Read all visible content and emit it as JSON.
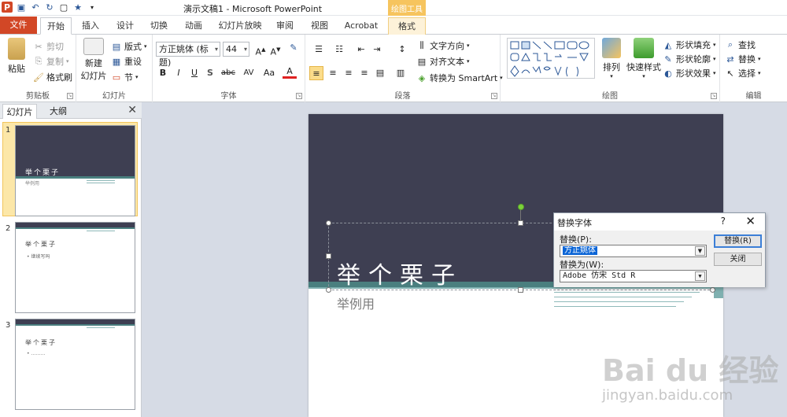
{
  "window": {
    "title": "演示文稿1 - Microsoft PowerPoint",
    "context_tab_header": "绘图工具"
  },
  "tabs": [
    "开始",
    "插入",
    "设计",
    "切换",
    "动画",
    "幻灯片放映",
    "审阅",
    "视图",
    "Acrobat",
    "格式"
  ],
  "file_tab": "文件",
  "ribbon": {
    "clipboard": {
      "label": "剪贴板",
      "paste": "粘贴",
      "cut": "剪切",
      "copy": "复制",
      "format_painter": "格式刷"
    },
    "slides": {
      "label": "幻灯片",
      "new_slide_1": "新建",
      "new_slide_2": "幻灯片",
      "layout": "版式",
      "reset": "重设",
      "section": "节"
    },
    "font": {
      "label": "字体",
      "font_name": "方正姚体 (标题)",
      "font_size": "44",
      "bold": "B",
      "italic": "I",
      "underline": "U",
      "shadow": "S",
      "strike": "abc",
      "spacing": "AV",
      "case": "Aa"
    },
    "paragraph": {
      "label": "段落",
      "text_direction": "文字方向",
      "align_text": "对齐文本",
      "smartart": "转换为 SmartArt"
    },
    "drawing": {
      "label": "绘图",
      "arrange": "排列",
      "quick_styles": "快速样式",
      "shape_fill": "形状填充",
      "shape_outline": "形状轮廓",
      "shape_effects": "形状效果"
    },
    "editing": {
      "label": "编辑",
      "find": "查找",
      "replace": "替换",
      "select": "选择"
    }
  },
  "pane": {
    "tabs": [
      "幻灯片",
      "大纲"
    ],
    "thumbs": [
      {
        "num": "1",
        "title": "举个栗子",
        "sub": "举例用"
      },
      {
        "num": "2",
        "title": "举个栗子",
        "bullet": "• 继续写吗"
      },
      {
        "num": "3",
        "title": "举个栗子",
        "bullet": "• ………"
      }
    ]
  },
  "slide": {
    "title": "举个栗子",
    "subtitle": "举例用"
  },
  "dialog": {
    "title": "替换字体",
    "help": "?",
    "close": "✕",
    "replace_label": "替换(P):",
    "replace_value": "方正姚体",
    "with_label": "替换为(W):",
    "with_value": "Adobe 仿宋 Std R",
    "replace_button": "替换(R)",
    "close_button": "关闭"
  },
  "watermark": {
    "logo": "Bai du 经验",
    "url": "jingyan.baidu.com"
  }
}
